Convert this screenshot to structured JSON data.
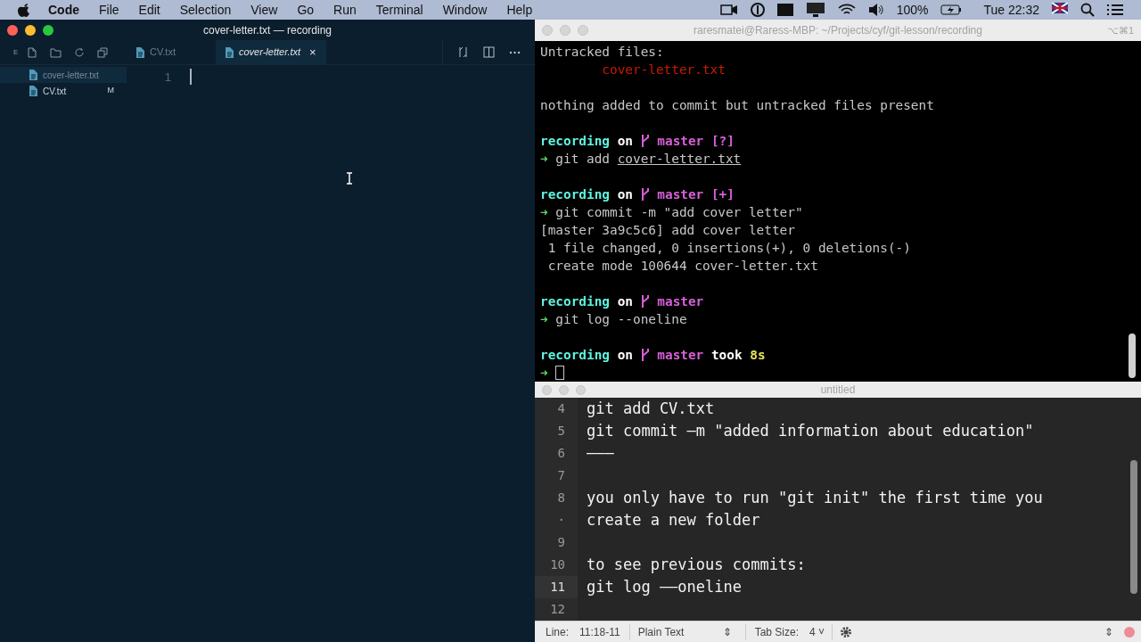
{
  "menubar": {
    "app": "Code",
    "items": [
      "File",
      "Edit",
      "Selection",
      "View",
      "Go",
      "Run",
      "Terminal",
      "Window",
      "Help"
    ],
    "battery": "100%",
    "clock": "Tue 22:32"
  },
  "vscode": {
    "title": "cover-letter.txt — recording",
    "explorer_label": "E",
    "tabs": [
      {
        "label": "CV.txt",
        "selected": false,
        "italic": false
      },
      {
        "label": "cover-letter.txt",
        "selected": true,
        "italic": true,
        "close": "×"
      }
    ],
    "files": [
      {
        "name": "cover-letter.txt",
        "selected": true
      },
      {
        "name": "CV.txt",
        "selected": false,
        "badge": "M"
      }
    ],
    "line_number": "1"
  },
  "terminal": {
    "title": "raresmatei@Raress-MBP: ~/Projects/cyf/git-lesson/recording",
    "shortcut": "⌥⌘1",
    "lines": [
      {
        "kind": "text",
        "segments": [
          {
            "text": "Untracked files:",
            "kind": "plain"
          }
        ]
      },
      {
        "kind": "text",
        "segments": [
          {
            "text": "        cover-letter.txt",
            "kind": "error"
          }
        ]
      },
      {
        "kind": "blank"
      },
      {
        "kind": "text",
        "segments": [
          {
            "text": "nothing added to commit but untracked files present",
            "kind": "plain"
          }
        ]
      },
      {
        "kind": "blank"
      },
      {
        "kind": "text",
        "segments": [
          {
            "text": "recording",
            "kind": "directory"
          },
          {
            "text": " on ",
            "kind": "keyword"
          },
          {
            "kind": "branch"
          },
          {
            "text": " master [?]",
            "kind": "git"
          }
        ]
      },
      {
        "kind": "text",
        "segments": [
          {
            "text": "➜ ",
            "kind": "prompt"
          },
          {
            "text": "git add ",
            "kind": "plain"
          },
          {
            "text": "cover-letter.txt",
            "kind": "path"
          }
        ]
      },
      {
        "kind": "blank"
      },
      {
        "kind": "text",
        "segments": [
          {
            "text": "recording",
            "kind": "directory"
          },
          {
            "text": " on ",
            "kind": "keyword"
          },
          {
            "kind": "branch"
          },
          {
            "text": " master [+]",
            "kind": "git"
          }
        ]
      },
      {
        "kind": "text",
        "segments": [
          {
            "text": "➜ ",
            "kind": "prompt"
          },
          {
            "text": "git commit -m \"add cover letter\"",
            "kind": "plain"
          }
        ]
      },
      {
        "kind": "text",
        "segments": [
          {
            "text": "[master 3a9c5c6] add cover letter",
            "kind": "plain"
          }
        ]
      },
      {
        "kind": "text",
        "segments": [
          {
            "text": " 1 file changed, 0 insertions(+), 0 deletions(-)",
            "kind": "plain"
          }
        ]
      },
      {
        "kind": "text",
        "segments": [
          {
            "text": " create mode 100644 cover-letter.txt",
            "kind": "plain"
          }
        ]
      },
      {
        "kind": "blank"
      },
      {
        "kind": "text",
        "segments": [
          {
            "text": "recording",
            "kind": "directory"
          },
          {
            "text": " on ",
            "kind": "keyword"
          },
          {
            "kind": "branch"
          },
          {
            "text": " master",
            "kind": "git"
          }
        ]
      },
      {
        "kind": "text",
        "segments": [
          {
            "text": "➜ ",
            "kind": "prompt"
          },
          {
            "text": "git log --oneline",
            "kind": "plain"
          }
        ]
      },
      {
        "kind": "blank"
      },
      {
        "kind": "text",
        "segments": [
          {
            "text": "recording",
            "kind": "directory"
          },
          {
            "text": " on ",
            "kind": "keyword"
          },
          {
            "kind": "branch"
          },
          {
            "text": " master",
            "kind": "git"
          },
          {
            "text": " took ",
            "kind": "keyword"
          },
          {
            "text": "8s",
            "kind": "duration"
          }
        ]
      },
      {
        "kind": "text",
        "segments": [
          {
            "text": "➜ ",
            "kind": "prompt"
          },
          {
            "kind": "cursor"
          }
        ]
      }
    ]
  },
  "notes": {
    "title": "untitled",
    "lines": [
      {
        "number": "4",
        "text": "git add CV.txt",
        "current": false
      },
      {
        "number": "5",
        "text": "git commit —m \"added information about education\"",
        "current": false
      },
      {
        "number": "6",
        "text": "———",
        "current": false
      },
      {
        "number": "7",
        "current": false
      },
      {
        "number": "8",
        "text": "you only have to run \"git init\" the first time you",
        "current": false
      },
      {
        "number": "·",
        "text": "create a new folder",
        "current": false
      },
      {
        "number": "9",
        "current": false
      },
      {
        "number": "10",
        "text": "to see previous commits:",
        "current": false
      },
      {
        "number": "11",
        "text": "git log ——oneline",
        "current": true
      },
      {
        "number": "12",
        "current": false
      }
    ],
    "status": {
      "line_label": "Line:",
      "line_value": "11:18-11",
      "syntax": "Plain Text",
      "syntax_arrows": "⇕",
      "tab_label": "Tab Size:",
      "tab_value": "4",
      "tab_caret": "˅",
      "end_arrows": "⇕"
    }
  }
}
